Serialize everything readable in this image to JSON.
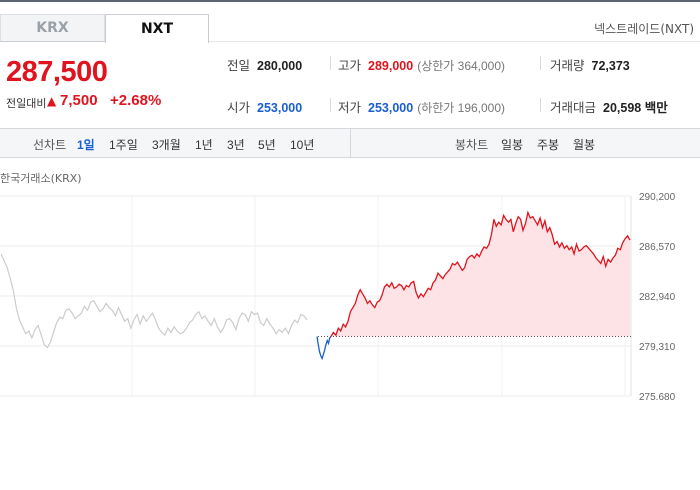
{
  "tabs": [
    {
      "label": "KRX",
      "active": false
    },
    {
      "label": "NXT",
      "active": true
    }
  ],
  "market_name": "넥스트레이드(NXT)",
  "price": {
    "current": "287,500",
    "change_label": "전일대비",
    "change_arrow": "▲",
    "change_amount": "7,500",
    "change_percent": "+2.68%"
  },
  "stats": {
    "prev_close": {
      "label": "전일",
      "value": "280,000"
    },
    "high": {
      "label": "고가",
      "value": "289,000",
      "sub": "(상한가 364,000)"
    },
    "volume": {
      "label": "거래량",
      "value": "72,373"
    },
    "open": {
      "label": "시가",
      "value": "253,000"
    },
    "low": {
      "label": "저가",
      "value": "253,000",
      "sub": "(하한가 196,000)"
    },
    "amount": {
      "label": "거래대금",
      "value": "20,598 백만"
    }
  },
  "toolbar": {
    "line_label": "선차트",
    "line_periods": [
      "1일",
      "1주일",
      "3개월",
      "1년",
      "3년",
      "5년",
      "10년"
    ],
    "active_period": "1일",
    "candle_label": "봉차트",
    "candle_periods": [
      "일봉",
      "주봉",
      "월봉"
    ]
  },
  "chart_source": "한국거래소(KRX)",
  "colors": {
    "up": "#e0141e",
    "down": "#1a5fd0",
    "reference": "#cccccc"
  },
  "chart_data": {
    "type": "line",
    "ylim": [
      275680,
      290200
    ],
    "yticks": [
      "290,200",
      "286,570",
      "282,940",
      "279,310",
      "275,680"
    ],
    "baseline": 280000,
    "series": [
      {
        "values": [
          286000,
          285500,
          285000,
          284200,
          283300,
          282000,
          281200,
          280700,
          280200,
          280400,
          279900,
          280500,
          280800,
          280100,
          279400,
          279200,
          279600,
          280300,
          281000,
          281400,
          281300,
          281900,
          282000,
          281700,
          281300,
          281500,
          281700,
          282200,
          281900,
          282500,
          282600,
          282200,
          281800,
          282000,
          282400,
          282100,
          281900,
          281500,
          282100,
          281600,
          281100,
          281300,
          280600,
          281200,
          281600,
          280900,
          281500,
          281100,
          281400,
          281700,
          281200,
          280600,
          280300,
          280100,
          280600,
          280300,
          280700,
          280400,
          280200,
          280300,
          280600,
          281000,
          281200,
          281600,
          281800,
          281300,
          281500,
          281100,
          280800,
          281300,
          280700,
          280300,
          280600,
          281200,
          281300,
          281000,
          280500,
          281300,
          281700,
          281600,
          281100,
          281800,
          281600,
          281700,
          281000,
          280800,
          281300,
          280900,
          280600,
          280200,
          280500,
          280300,
          280600,
          280200,
          280800,
          281200,
          281000,
          281600,
          281500,
          281200
        ]
      },
      {
        "values": [
          280000,
          279400,
          278900,
          278600,
          278400,
          278700,
          279000,
          279400,
          279700,
          279500,
          279900,
          280000
        ]
      },
      {
        "values": [
          280000,
          280300,
          280100,
          280600,
          280400,
          280900,
          280700,
          281100,
          281800,
          282100,
          282400,
          283000,
          283400,
          283100,
          282800,
          282400,
          282600,
          282300,
          282100,
          282500,
          282600,
          283000,
          283600,
          283800,
          283600,
          283900,
          283500,
          283600,
          283800,
          283700,
          283400,
          283700,
          283600,
          283900,
          284000,
          283200,
          282800,
          283100,
          282900,
          283200,
          283500,
          283400,
          283900,
          284100,
          284600,
          284400,
          284200,
          284500,
          284700,
          284900,
          285300,
          285200,
          285400,
          285100,
          284800,
          285000,
          285600,
          285800,
          285900,
          285700,
          286000,
          285800,
          286200,
          286500,
          286400,
          286700,
          287400,
          288500,
          288000,
          288300,
          288100,
          288800,
          288500,
          288300,
          288500,
          287600,
          288200,
          288700,
          288500,
          287700,
          288200,
          289000,
          288600,
          288700,
          288400,
          288100,
          288600,
          287900,
          288400,
          287600,
          287900,
          287400,
          286700,
          286900,
          286500,
          286800,
          286400,
          286600,
          286300,
          286500,
          286000,
          286700,
          286200,
          286300,
          286500,
          286600,
          286400,
          286200,
          286000,
          285700,
          285500,
          285300,
          285800,
          285100,
          285600,
          285400,
          285700,
          285900,
          286400,
          286300,
          286800,
          287100,
          287300,
          287000
        ]
      }
    ]
  }
}
